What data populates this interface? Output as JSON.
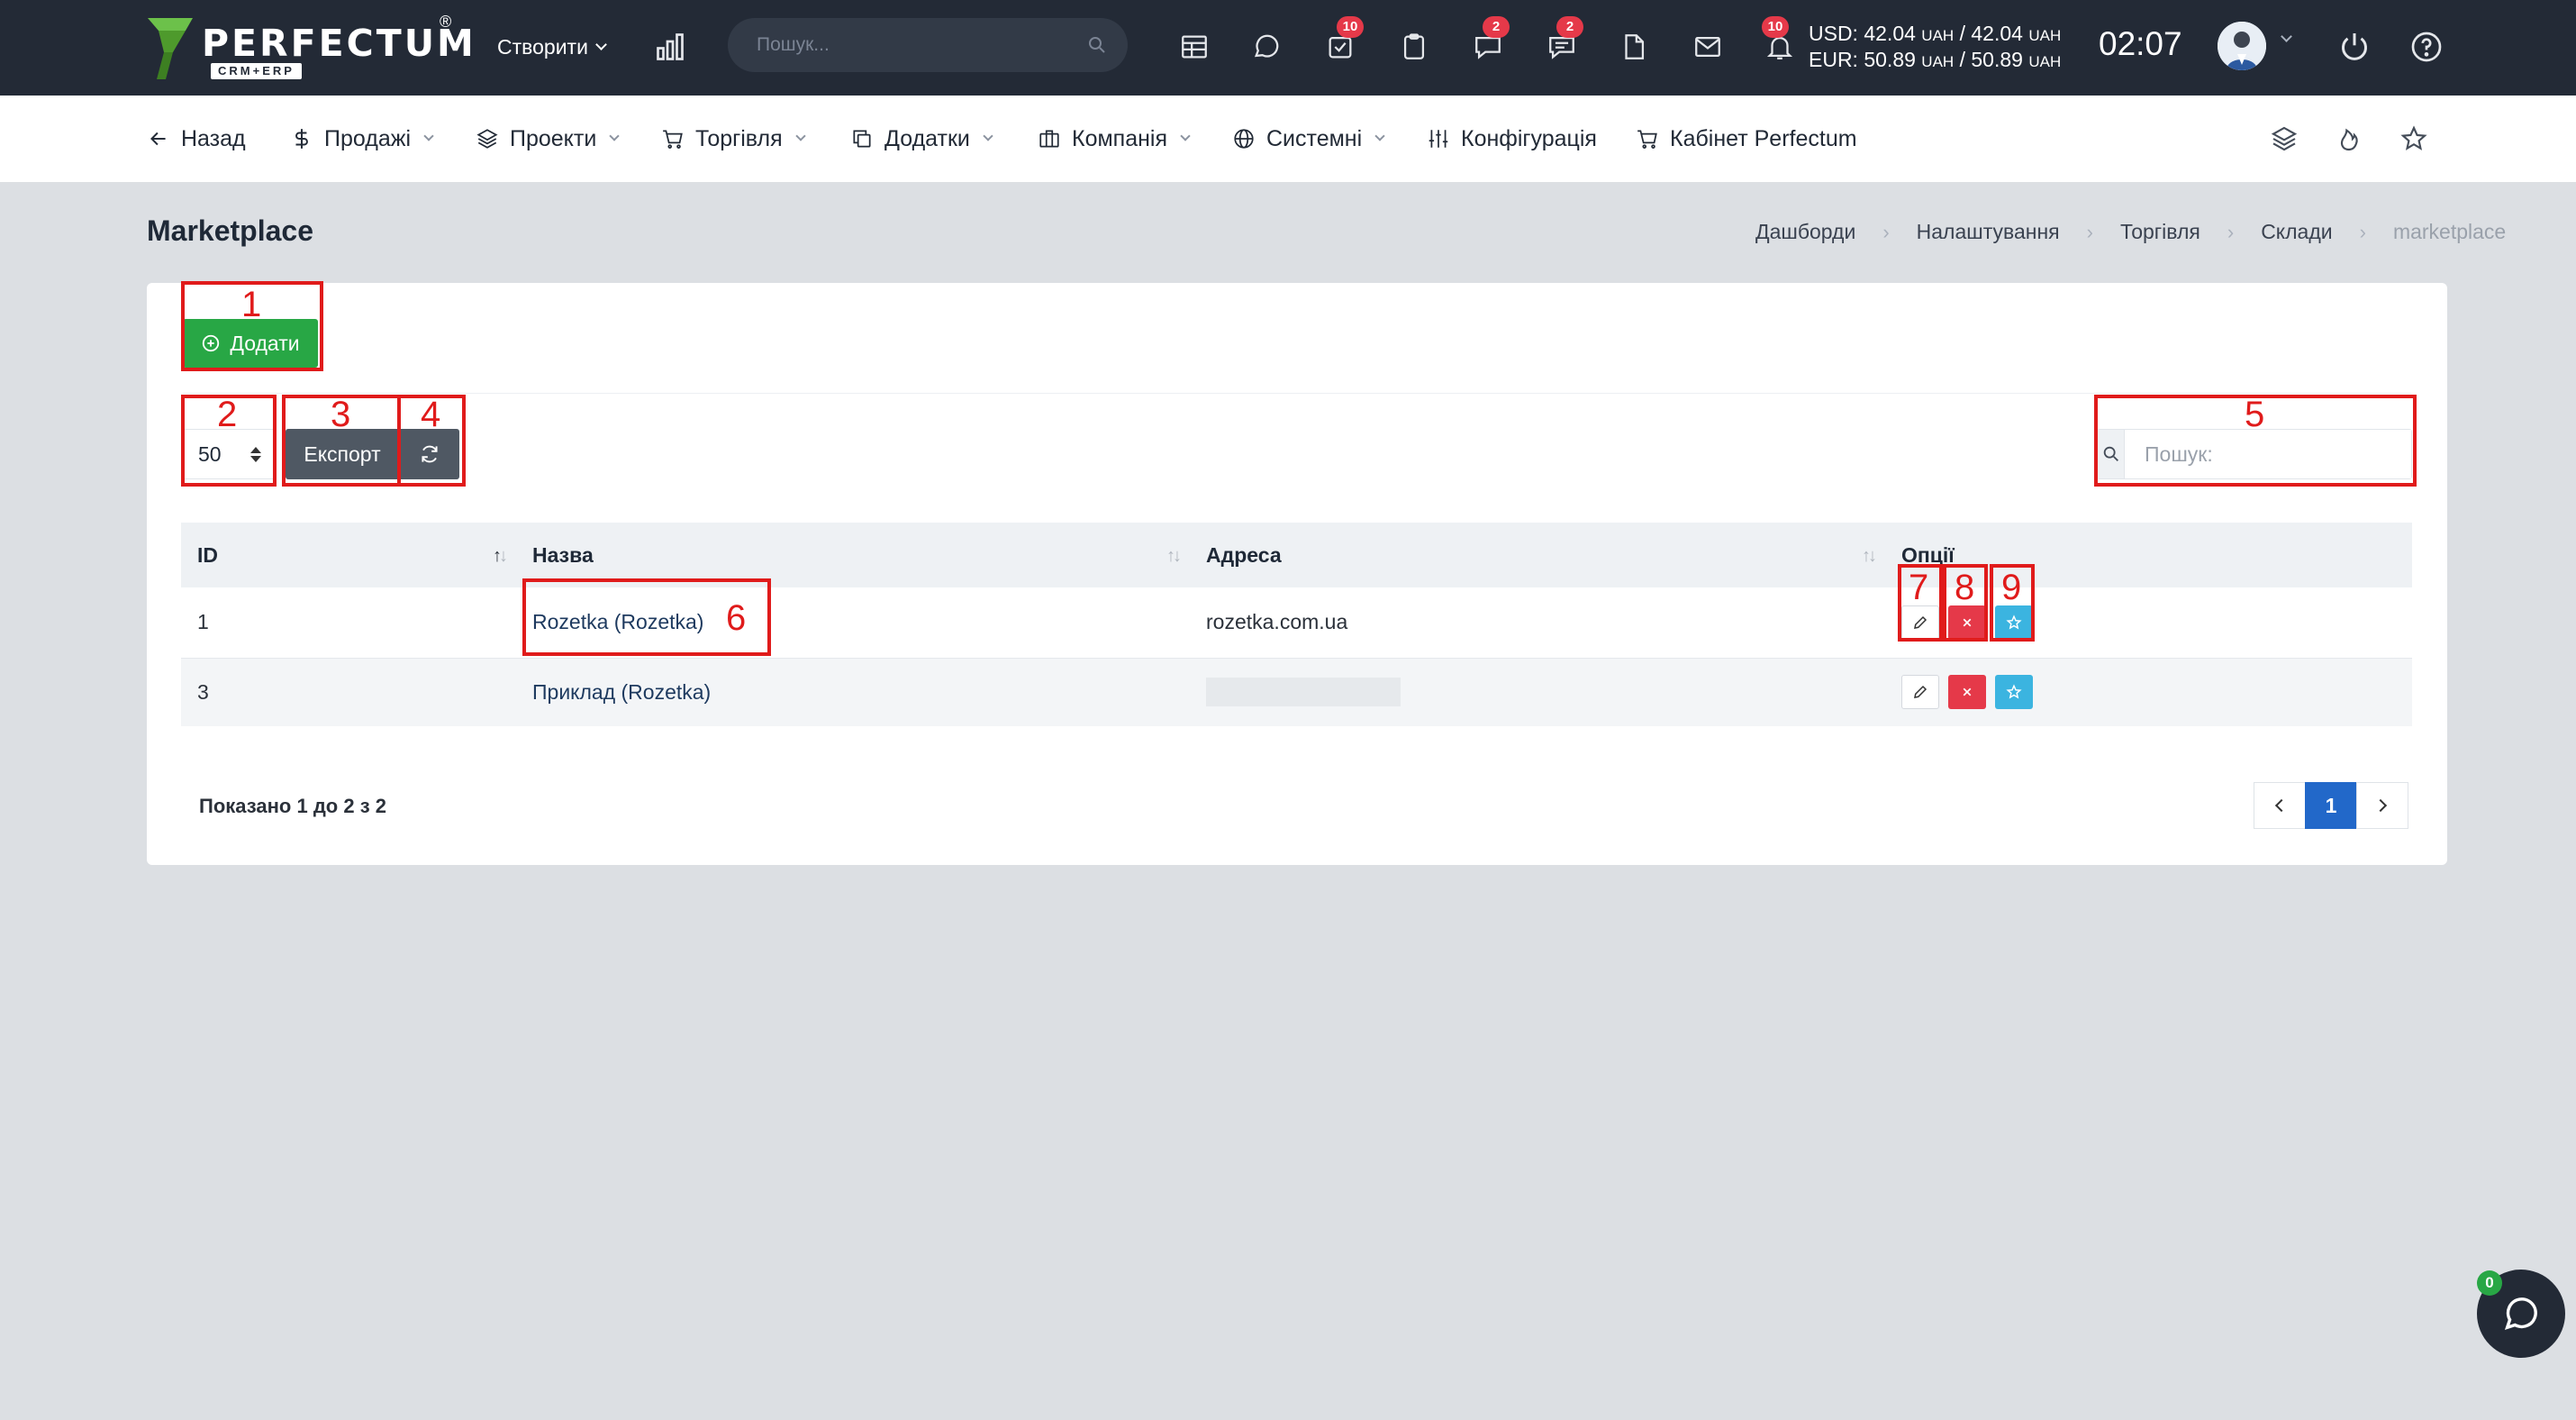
{
  "brand": {
    "name": "PERFECTUM",
    "reg": "®",
    "sub": "CRM+ERP",
    "color": "#5fb130"
  },
  "topbar": {
    "create_label": "Створити",
    "search_placeholder": "Пошук...",
    "badges": {
      "tasks": "10",
      "support": "2",
      "discussions": "2",
      "notifications": "10"
    },
    "usd": {
      "label": "USD:",
      "v1": "42.04",
      "v2": "42.04",
      "unit": "UAH"
    },
    "eur": {
      "label": "EUR:",
      "v1": "50.89",
      "v2": "50.89",
      "unit": "UAH"
    },
    "time": "02:07"
  },
  "nav": {
    "back": "Назад",
    "sales": "Продажі",
    "projects": "Проекти",
    "trade": "Торгівля",
    "addons": "Додатки",
    "company": "Компанія",
    "system": "Системні",
    "config": "Конфігурація",
    "cabinet": "Кабінет Perfectum"
  },
  "page": {
    "title": "Marketplace",
    "breadcrumb": [
      "Дашборди",
      "Налаштування",
      "Торгівля",
      "Склади",
      "marketplace"
    ]
  },
  "toolbar": {
    "add_label": "Додати",
    "page_length": "50",
    "export_label": "Експорт",
    "search_placeholder": "Пошук:"
  },
  "table": {
    "columns": [
      "ID",
      "Назва",
      "Адреса",
      "Опції"
    ],
    "rows": [
      {
        "id": "1",
        "name": "Rozetka (Rozetka)",
        "address": "rozetka.com.ua"
      },
      {
        "id": "3",
        "name": "Приклад (Rozetka)",
        "address": ""
      }
    ]
  },
  "footer": {
    "info": "Показано 1 до 2 з 2",
    "current_page": "1"
  },
  "annotations": [
    "1",
    "2",
    "3",
    "4",
    "5",
    "6",
    "7",
    "8",
    "9"
  ],
  "chat": {
    "badge": "0"
  }
}
